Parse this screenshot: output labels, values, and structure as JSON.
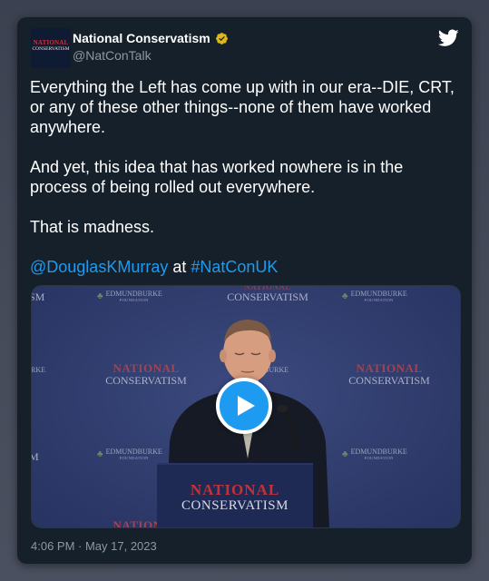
{
  "tweet": {
    "author": {
      "name": "National Conservatism",
      "handle": "@NatConTalk",
      "verified": true,
      "avatar_text_top": "NATIONAL",
      "avatar_text_bottom": "CONSERVATISM"
    },
    "text_paragraphs": [
      "Everything the Left has come up with in our era--DIE, CRT, or any of these other things--none of them have worked anywhere.",
      "And yet, this idea that has worked nowhere is in the process of being rolled out everywhere.",
      "That is madness."
    ],
    "mention": "@DouglasKMurray",
    "connector": " at ",
    "hashtag": "#NatConUK",
    "timestamp": "4:06 PM · May 17, 2023",
    "icons": {
      "platform": "twitter-bird-icon",
      "badge": "verified-badge-icon",
      "play": "play-icon"
    }
  },
  "media": {
    "type": "video",
    "backdrop": {
      "national": "NATIONAL",
      "conservatism": "CONSERVATISM",
      "edmund_burke": "EDMUNDBURKE",
      "foundation": "FOUNDATION",
      "edge_left_1": "SM",
      "edge_left_2": "RKE",
      "edge_left_3": "M",
      "burke_center": "BURKE"
    },
    "podium": {
      "line1": "NATIONAL",
      "line2": "CONSERVATISM"
    }
  },
  "colors": {
    "card_bg": "#15202b",
    "link": "#1d9bf0",
    "muted": "#8b98a5",
    "badge_gold": "#e2b719"
  }
}
